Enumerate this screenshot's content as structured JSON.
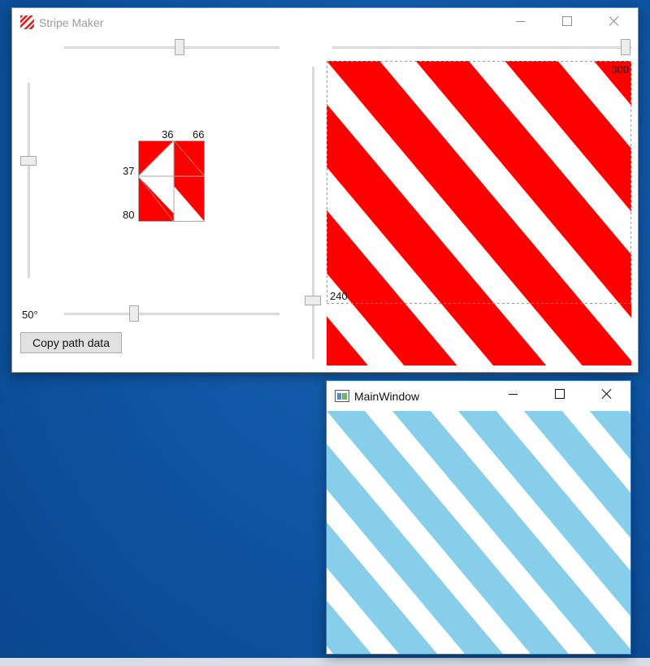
{
  "stripe_maker": {
    "title": "Stripe Maker",
    "tile_labels": {
      "top_left": "36",
      "top_right": "66",
      "left_upper": "37",
      "left_lower": "80"
    },
    "angle_label": "50°",
    "copy_button_label": "Copy path data",
    "canvas": {
      "width_label": "300",
      "height_label": "240",
      "stripe_color": "#ff0000",
      "background_color": "#ffffff"
    },
    "sliders": {
      "top_left_fraction": 0.54,
      "top_right_fraction": 1.0,
      "left_vertical_fraction": 0.39,
      "bottom_fraction": 0.33,
      "middle_vertical_fraction": 0.8
    }
  },
  "main_window": {
    "title": "MainWindow",
    "stripe_color": "#87ceeb",
    "background_color": "#ffffff"
  },
  "icons": {
    "app": "stripe-icon",
    "main_window": "window-icon",
    "minimize": "minimize-icon",
    "maximize": "maximize-icon",
    "close": "close-icon"
  }
}
